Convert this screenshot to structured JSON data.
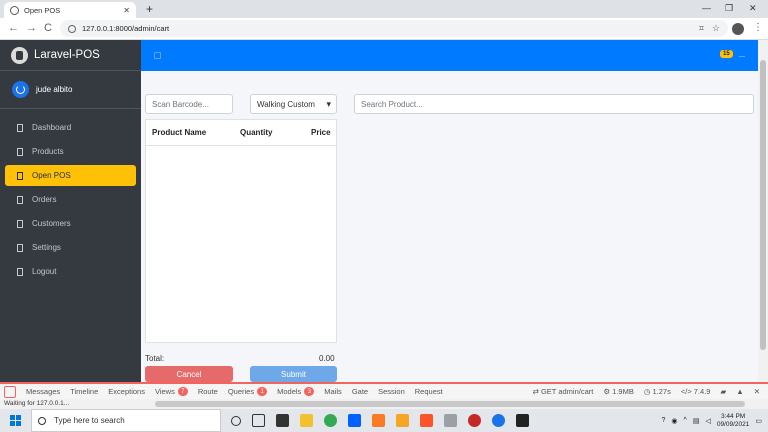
{
  "browser": {
    "tab_title": "Open POS",
    "tab_close": "✕",
    "new_tab": "+",
    "url": "127.0.0.1:8000/admin/cart",
    "back": "←",
    "forward": "→",
    "reload": "C"
  },
  "sidebar": {
    "brand": "Laravel-POS",
    "user_name": "jude albito",
    "items": [
      {
        "label": "Dashboard",
        "icon": "dashboard-icon",
        "active": false
      },
      {
        "label": "Products",
        "icon": "products-icon",
        "active": false
      },
      {
        "label": "Open POS",
        "icon": "pos-icon",
        "active": true
      },
      {
        "label": "Orders",
        "icon": "orders-icon",
        "active": false
      },
      {
        "label": "Customers",
        "icon": "customers-icon",
        "active": false
      },
      {
        "label": "Settings",
        "icon": "settings-icon",
        "active": false
      },
      {
        "label": "Logout",
        "icon": "logout-icon",
        "active": false
      }
    ]
  },
  "topbar": {
    "color": "#007bff",
    "lang_badge": "15"
  },
  "pos": {
    "barcode_placeholder": "Scan Barcode...",
    "customer_selected": "Walking Custom",
    "product_search_placeholder": "Search Product...",
    "table_headers": [
      "Product Name",
      "Quantity",
      "Price"
    ],
    "rows": [],
    "total_label": "Total:",
    "total_value": "0.00",
    "cancel_label": "Cancel",
    "submit_label": "Submit"
  },
  "debugbar": {
    "tabs": [
      {
        "label": "Messages"
      },
      {
        "label": "Timeline"
      },
      {
        "label": "Exceptions"
      },
      {
        "label": "Views",
        "badge": "7"
      },
      {
        "label": "Route"
      },
      {
        "label": "Queries",
        "badge": "1"
      },
      {
        "label": "Models",
        "badge": "3"
      },
      {
        "label": "Mails"
      },
      {
        "label": "Gate"
      },
      {
        "label": "Session"
      },
      {
        "label": "Request"
      }
    ],
    "request": "GET admin/cart",
    "memory": "1.9MB",
    "time": "1.27s",
    "php": "7.4.9"
  },
  "status": "Waiting for 127.0.0.1...",
  "taskbar": {
    "search_placeholder": "Type here to search",
    "time": "3:44 PM",
    "date": "09/09/2021"
  }
}
